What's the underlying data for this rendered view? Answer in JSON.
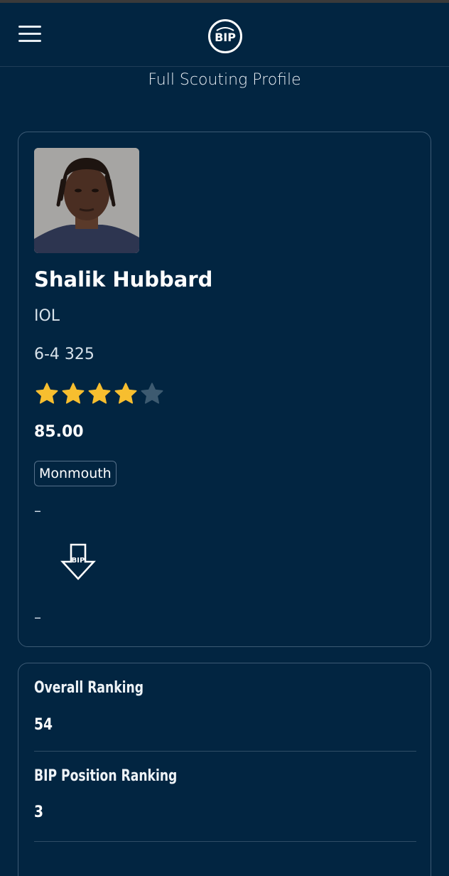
{
  "header": {
    "menu_icon": "hamburger-menu-icon",
    "logo_text": "BIP",
    "page_title": "Full Scouting Profile"
  },
  "player": {
    "name": "Shalik Hubbard",
    "position": "IOL",
    "size": "6-4 325",
    "stars_filled": 4,
    "stars_total": 5,
    "rating": "85.00",
    "school": "Monmouth",
    "line1": "–",
    "line2": "–",
    "bip_badge_text": "BIP"
  },
  "rankings": {
    "overall_label": "Overall Ranking",
    "overall_value": "54",
    "position_label": "BIP Position Ranking",
    "position_value": "3"
  },
  "colors": {
    "background": "#022541",
    "star_filled": "#f7be2f",
    "star_empty": "#3d5a70"
  }
}
